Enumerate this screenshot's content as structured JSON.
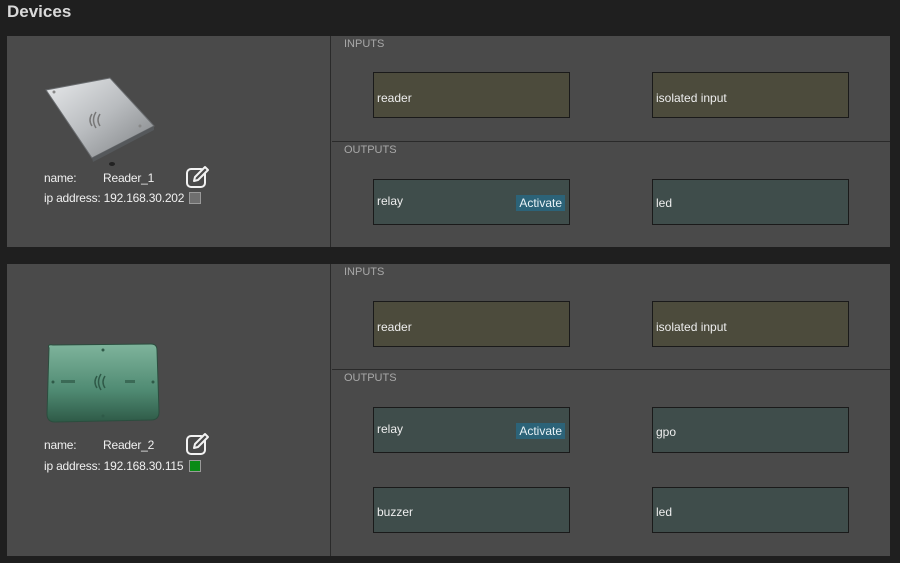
{
  "page": {
    "title": "Devices"
  },
  "colors": {
    "status_offline": "#6f6f6f",
    "status_online": "#0a8a16",
    "input_tile": "#4c4b3c",
    "output_tile": "#3f4d4b",
    "activate_button": "#2c6378"
  },
  "devices": [
    {
      "name_label": "name:",
      "name": "Reader_1",
      "ip_label": "ip address:",
      "ip": "192.168.30.202",
      "status": "offline",
      "inputs_label": "INPUTS",
      "outputs_label": "OUTPUTS",
      "inputs": [
        "reader",
        "isolated input"
      ],
      "outputs": [
        {
          "label": "relay",
          "action": "Activate"
        },
        {
          "label": "led"
        }
      ]
    },
    {
      "name_label": "name:",
      "name": "Reader_2",
      "ip_label": "ip address:",
      "ip": "192.168.30.115",
      "status": "online",
      "inputs_label": "INPUTS",
      "outputs_label": "OUTPUTS",
      "inputs": [
        "reader",
        "isolated input"
      ],
      "outputs": [
        {
          "label": "relay",
          "action": "Activate"
        },
        {
          "label": "gpo"
        },
        {
          "label": "buzzer"
        },
        {
          "label": "led"
        }
      ]
    }
  ]
}
